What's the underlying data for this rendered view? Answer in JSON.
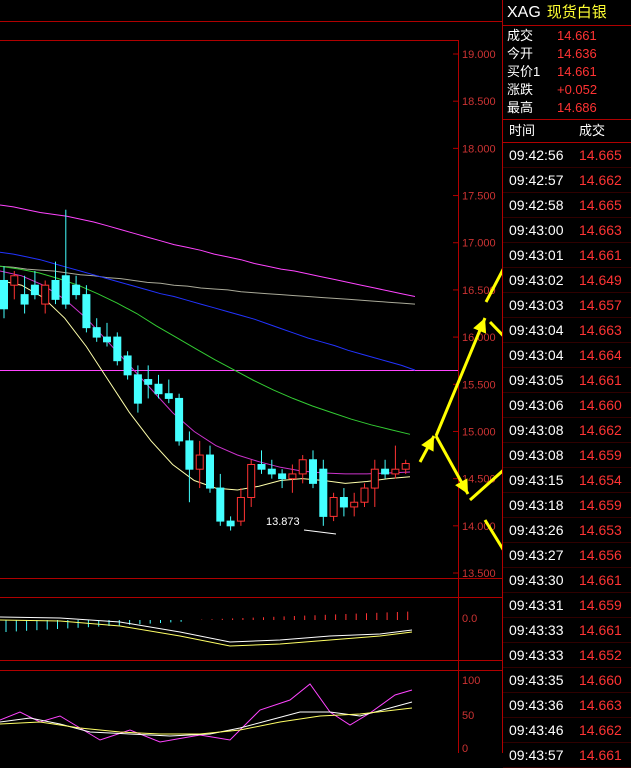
{
  "instrument": {
    "code": "XAG",
    "name": "现货白银"
  },
  "quote": [
    {
      "label": "成交",
      "value": "14.661"
    },
    {
      "label": "今开",
      "value": "14.636"
    },
    {
      "label": "买价1",
      "value": "14.661"
    },
    {
      "label": "涨跌",
      "value": "+0.052"
    },
    {
      "label": "最高",
      "value": "14.686"
    }
  ],
  "trades_header": {
    "time": "时间",
    "price": "成交"
  },
  "trades": [
    {
      "time": "09:42:56",
      "price": "14.665"
    },
    {
      "time": "09:42:57",
      "price": "14.662"
    },
    {
      "time": "09:42:58",
      "price": "14.665"
    },
    {
      "time": "09:43:00",
      "price": "14.663"
    },
    {
      "time": "09:43:01",
      "price": "14.661"
    },
    {
      "time": "09:43:02",
      "price": "14.649"
    },
    {
      "time": "09:43:03",
      "price": "14.657"
    },
    {
      "time": "09:43:04",
      "price": "14.663"
    },
    {
      "time": "09:43:04",
      "price": "14.664"
    },
    {
      "time": "09:43:05",
      "price": "14.661"
    },
    {
      "time": "09:43:06",
      "price": "14.660"
    },
    {
      "time": "09:43:08",
      "price": "14.662"
    },
    {
      "time": "09:43:08",
      "price": "14.659"
    },
    {
      "time": "09:43:15",
      "price": "14.654"
    },
    {
      "time": "09:43:18",
      "price": "14.659"
    },
    {
      "time": "09:43:26",
      "price": "14.653"
    },
    {
      "time": "09:43:27",
      "price": "14.656"
    },
    {
      "time": "09:43:30",
      "price": "14.661"
    },
    {
      "time": "09:43:31",
      "price": "14.659"
    },
    {
      "time": "09:43:33",
      "price": "14.661"
    },
    {
      "time": "09:43:33",
      "price": "14.652"
    },
    {
      "time": "09:43:35",
      "price": "14.660"
    },
    {
      "time": "09:43:36",
      "price": "14.663"
    },
    {
      "time": "09:43:46",
      "price": "14.662"
    },
    {
      "time": "09:43:57",
      "price": "14.661"
    }
  ],
  "chart_data": {
    "type": "candlestick",
    "ylim": [
      13.5,
      19.0
    ],
    "y_ticks": [
      "19.000",
      "18.500",
      "18.000",
      "17.500",
      "17.000",
      "16.500",
      "16.000",
      "15.500",
      "15.000",
      "14.500",
      "14.000",
      "13.500"
    ],
    "low_annotation": "13.873",
    "candles": [
      {
        "o": 16.6,
        "h": 16.75,
        "l": 16.2,
        "c": 16.3
      },
      {
        "o": 16.55,
        "h": 16.7,
        "l": 16.4,
        "c": 16.65
      },
      {
        "o": 16.45,
        "h": 16.65,
        "l": 16.25,
        "c": 16.35
      },
      {
        "o": 16.55,
        "h": 16.7,
        "l": 16.4,
        "c": 16.45
      },
      {
        "o": 16.35,
        "h": 16.6,
        "l": 16.25,
        "c": 16.55
      },
      {
        "o": 16.6,
        "h": 16.8,
        "l": 16.35,
        "c": 16.4
      },
      {
        "o": 16.65,
        "h": 17.35,
        "l": 16.3,
        "c": 16.35
      },
      {
        "o": 16.55,
        "h": 16.65,
        "l": 16.4,
        "c": 16.45
      },
      {
        "o": 16.45,
        "h": 16.55,
        "l": 16.05,
        "c": 16.1
      },
      {
        "o": 16.1,
        "h": 16.2,
        "l": 15.95,
        "c": 16.0
      },
      {
        "o": 16.0,
        "h": 16.15,
        "l": 15.9,
        "c": 15.95
      },
      {
        "o": 16.0,
        "h": 16.05,
        "l": 15.7,
        "c": 15.75
      },
      {
        "o": 15.8,
        "h": 15.85,
        "l": 15.55,
        "c": 15.6
      },
      {
        "o": 15.6,
        "h": 15.7,
        "l": 15.2,
        "c": 15.3
      },
      {
        "o": 15.55,
        "h": 15.7,
        "l": 15.35,
        "c": 15.5
      },
      {
        "o": 15.5,
        "h": 15.6,
        "l": 15.35,
        "c": 15.4
      },
      {
        "o": 15.4,
        "h": 15.55,
        "l": 15.3,
        "c": 15.35
      },
      {
        "o": 15.35,
        "h": 15.4,
        "l": 14.85,
        "c": 14.9
      },
      {
        "o": 14.9,
        "h": 15.0,
        "l": 14.25,
        "c": 14.6
      },
      {
        "o": 14.6,
        "h": 14.9,
        "l": 14.4,
        "c": 14.75
      },
      {
        "o": 14.75,
        "h": 14.85,
        "l": 14.35,
        "c": 14.4
      },
      {
        "o": 14.4,
        "h": 14.55,
        "l": 14.0,
        "c": 14.05
      },
      {
        "o": 14.05,
        "h": 14.1,
        "l": 13.95,
        "c": 14.0
      },
      {
        "o": 14.05,
        "h": 14.4,
        "l": 14.0,
        "c": 14.3
      },
      {
        "o": 14.3,
        "h": 14.7,
        "l": 14.2,
        "c": 14.65
      },
      {
        "o": 14.65,
        "h": 14.8,
        "l": 14.55,
        "c": 14.6
      },
      {
        "o": 14.6,
        "h": 14.7,
        "l": 14.5,
        "c": 14.55
      },
      {
        "o": 14.55,
        "h": 14.6,
        "l": 14.4,
        "c": 14.5
      },
      {
        "o": 14.5,
        "h": 14.65,
        "l": 14.35,
        "c": 14.55
      },
      {
        "o": 14.55,
        "h": 14.75,
        "l": 14.45,
        "c": 14.7
      },
      {
        "o": 14.7,
        "h": 14.8,
        "l": 14.4,
        "c": 14.45
      },
      {
        "o": 14.6,
        "h": 14.7,
        "l": 14.0,
        "c": 14.1
      },
      {
        "o": 14.1,
        "h": 14.35,
        "l": 14.05,
        "c": 14.3
      },
      {
        "o": 14.3,
        "h": 14.4,
        "l": 14.1,
        "c": 14.2
      },
      {
        "o": 14.2,
        "h": 14.35,
        "l": 14.1,
        "c": 14.25
      },
      {
        "o": 14.25,
        "h": 14.45,
        "l": 14.2,
        "c": 14.4
      },
      {
        "o": 14.4,
        "h": 14.7,
        "l": 14.2,
        "c": 14.6
      },
      {
        "o": 14.6,
        "h": 14.7,
        "l": 14.5,
        "c": 14.55
      },
      {
        "o": 14.55,
        "h": 14.85,
        "l": 14.5,
        "c": 14.6
      },
      {
        "o": 14.6,
        "h": 14.7,
        "l": 14.55,
        "c": 14.66
      }
    ],
    "ma_lines": [
      {
        "color": "#ff44ff",
        "values": [
          17.4,
          17.38,
          17.35,
          17.32,
          17.3,
          17.28,
          17.25,
          17.22,
          17.18,
          17.14,
          17.1,
          17.06,
          17.02,
          16.98,
          16.95,
          16.92,
          16.88,
          16.85,
          16.82,
          16.78,
          16.75,
          16.72,
          16.7,
          16.67,
          16.64,
          16.61,
          16.58,
          16.55,
          16.52,
          16.49,
          16.46,
          16.43
        ]
      },
      {
        "color": "#aaaa99",
        "values": [
          16.75,
          16.74,
          16.72,
          16.71,
          16.7,
          16.68,
          16.66,
          16.65,
          16.63,
          16.62,
          16.6,
          16.58,
          16.57,
          16.55,
          16.54,
          16.52,
          16.51,
          16.5,
          16.48,
          16.47,
          16.46,
          16.45,
          16.44,
          16.43,
          16.42,
          16.41,
          16.4,
          16.39,
          16.38,
          16.37,
          16.36,
          16.35
        ]
      },
      {
        "color": "#2233ff",
        "values": [
          16.9,
          16.88,
          16.85,
          16.82,
          16.78,
          16.74,
          16.7,
          16.66,
          16.62,
          16.58,
          16.54,
          16.5,
          16.46,
          16.43,
          16.39,
          16.35,
          16.31,
          16.27,
          16.23,
          16.19,
          16.14,
          16.09,
          16.04,
          15.99,
          15.95,
          15.91,
          15.86,
          15.82,
          15.78,
          15.74,
          15.7,
          15.65
        ]
      },
      {
        "color": "#33cc33",
        "values": [
          16.75,
          16.72,
          16.68,
          16.62,
          16.55,
          16.46,
          16.36,
          16.25,
          16.12,
          16.0,
          15.88,
          15.76,
          15.65,
          15.54,
          15.44,
          15.35,
          15.27,
          15.2,
          15.13,
          15.07,
          15.02,
          14.97
        ]
      },
      {
        "color": "#cc33cc",
        "values": [
          16.7,
          16.65,
          16.55,
          16.4,
          16.2,
          15.95,
          15.7,
          15.45,
          15.2,
          15.0,
          14.85,
          14.75,
          14.68,
          14.62,
          14.58,
          14.56,
          14.55,
          14.55,
          14.56,
          14.57
        ]
      },
      {
        "color": "#ffffaa",
        "values": [
          16.6,
          16.55,
          16.42,
          16.2,
          15.9,
          15.55,
          15.2,
          14.9,
          14.65,
          14.48,
          14.4,
          14.38,
          14.42,
          14.48,
          14.5,
          14.48,
          14.45,
          14.47,
          14.5,
          14.52
        ]
      }
    ],
    "indicator1_label": "0.0",
    "indicator2_labels": [
      "100",
      "50",
      "0"
    ]
  }
}
